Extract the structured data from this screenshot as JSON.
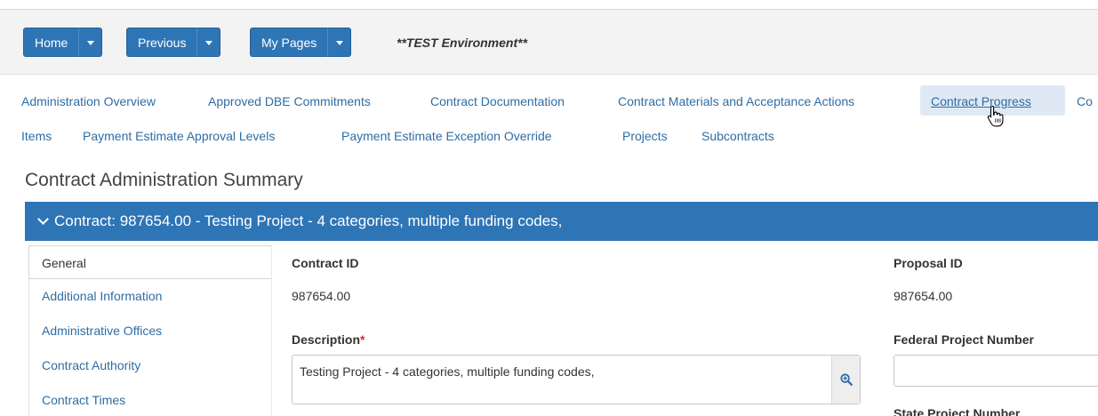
{
  "toolbar": {
    "home_label": "Home",
    "previous_label": "Previous",
    "mypages_label": "My Pages",
    "environment": "**TEST Environment**"
  },
  "nav": {
    "row1": [
      "Administration Overview",
      "Approved DBE Commitments",
      "Contract Documentation",
      "Contract Materials and Acceptance Actions",
      "Contract Progress",
      "Co"
    ],
    "row2": [
      "Items",
      "Payment Estimate Approval Levels",
      "Payment Estimate Exception Override",
      "Projects",
      "Subcontracts"
    ],
    "active": "Contract Progress"
  },
  "page": {
    "title": "Contract Administration Summary",
    "contract_header": "Contract: 987654.00 - Testing Project - 4 categories, multiple funding codes,"
  },
  "sidebar": {
    "items": [
      "General",
      "Additional Information",
      "Administrative Offices",
      "Contract Authority",
      "Contract Times"
    ],
    "active": "General"
  },
  "form": {
    "contract_id_label": "Contract ID",
    "contract_id_value": "987654.00",
    "description_label": "Description",
    "required_marker": "*",
    "description_value": "Testing Project - 4 categories, multiple funding codes,",
    "proposal_id_label": "Proposal ID",
    "proposal_id_value": "987654.00",
    "federal_project_number_label": "Federal Project Number",
    "federal_project_number_value": "",
    "state_project_number_label": "State Project Number"
  },
  "colors": {
    "primary": "#2e75b6",
    "link": "#2e6da4",
    "active_nav_bg": "#dfe9f4",
    "required": "#c9302c"
  },
  "icons": {
    "zoom": "zoom-in-icon",
    "caret": "caret-down-icon",
    "chevron": "chevron-down-icon",
    "cursor": "hand-pointer-icon"
  }
}
